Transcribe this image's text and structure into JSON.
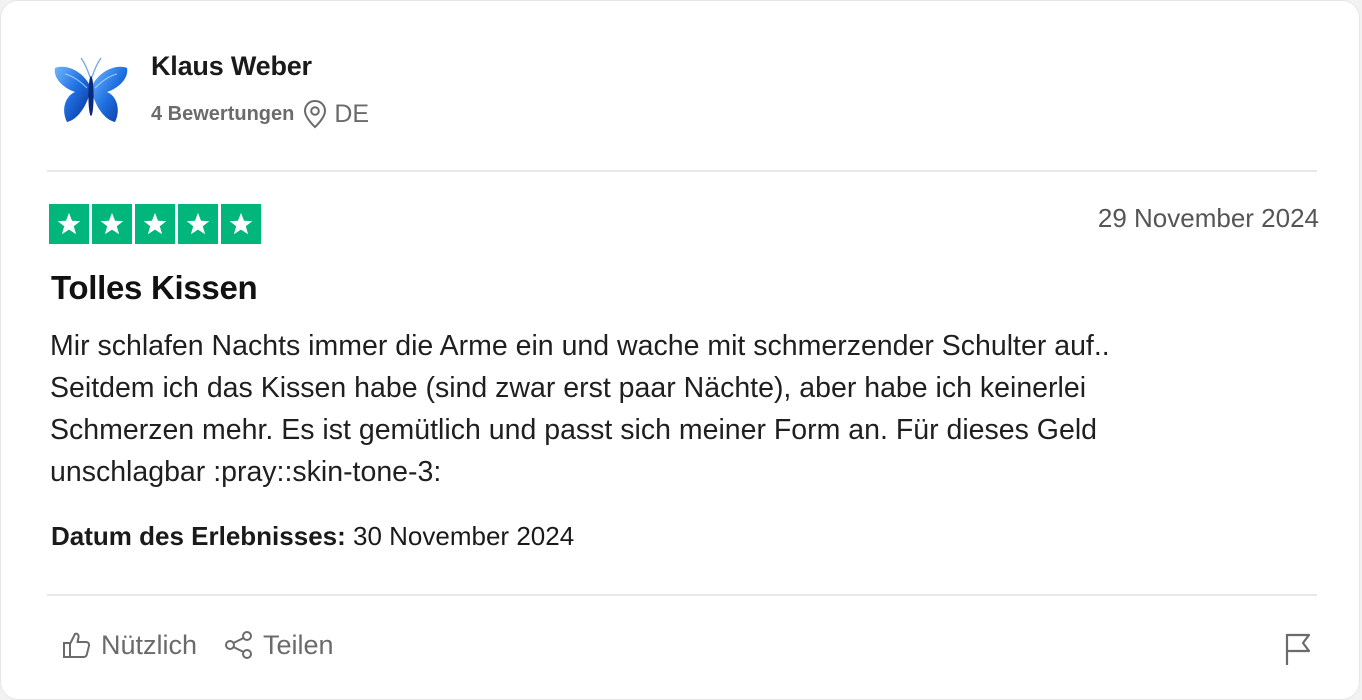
{
  "reviewer": {
    "name": "Klaus Weber",
    "review_count": "4 Bewertungen",
    "country": "DE",
    "avatar_icon": "butterfly-icon"
  },
  "review": {
    "rating": 5,
    "rating_max": 5,
    "date": "29 November 2024",
    "title": "Tolles Kissen",
    "body": "Mir schlafen Nachts immer die Arme ein und wache mit schmerzender Schulter auf..\nSeitdem ich das Kissen habe (sind zwar erst paar Nächte), aber habe ich keinerlei\nSchmerzen mehr. Es ist gemütlich und passt sich meiner Form an. Für dieses Geld\nunschlagbar :pray::skin-tone-3:",
    "experience_label": "Datum des Erlebnisses:",
    "experience_date": "30 November 2024"
  },
  "actions": {
    "useful_label": "Nützlich",
    "share_label": "Teilen",
    "useful_icon": "thumbs-up-icon",
    "share_icon": "share-icon",
    "report_icon": "flag-icon"
  },
  "colors": {
    "star_green": "#00b67a",
    "avatar_blue": "#1e6fe0",
    "muted_text": "#6b6b6b"
  }
}
